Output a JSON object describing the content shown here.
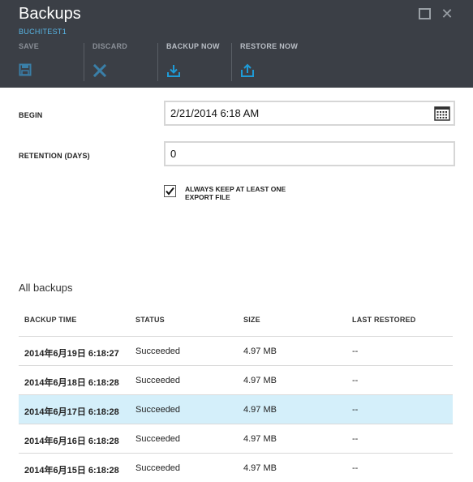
{
  "blade": {
    "title": "Backups",
    "subtitle": "BUCHITEST1"
  },
  "commands": [
    {
      "label": "SAVE",
      "icon": "save-icon",
      "enabled": false
    },
    {
      "label": "DISCARD",
      "icon": "discard-icon",
      "enabled": false
    },
    {
      "label": "BACKUP NOW",
      "icon": "backup-now-icon",
      "enabled": true
    },
    {
      "label": "RESTORE NOW",
      "icon": "restore-now-icon",
      "enabled": true
    }
  ],
  "form": {
    "begin_label": "BEGIN",
    "begin_value": "2/21/2014 6:18 AM",
    "retention_label": "RETENTION (DAYS)",
    "retention_value": "0",
    "keep_export_label": "ALWAYS KEEP AT LEAST ONE EXPORT FILE",
    "keep_export_checked": true
  },
  "backups": {
    "title": "All backups",
    "columns": [
      "BACKUP TIME",
      "STATUS",
      "SIZE",
      "LAST RESTORED"
    ],
    "rows": [
      {
        "time": "2014年6月19日 6:18:27",
        "status": "Succeeded",
        "size": "4.97 MB",
        "last_restored": "--"
      },
      {
        "time": "2014年6月18日 6:18:28",
        "status": "Succeeded",
        "size": "4.97 MB",
        "last_restored": "--"
      },
      {
        "time": "2014年6月17日 6:18:28",
        "status": "Succeeded",
        "size": "4.97 MB",
        "last_restored": "--"
      },
      {
        "time": "2014年6月16日 6:18:28",
        "status": "Succeeded",
        "size": "4.97 MB",
        "last_restored": "--"
      },
      {
        "time": "2014年6月15日 6:18:28",
        "status": "Succeeded",
        "size": "4.97 MB",
        "last_restored": "--"
      }
    ],
    "selected_row": 2
  },
  "colors": {
    "header_bg": "#3b3f46",
    "accent": "#1e9bd7",
    "selected_row": "#d4effa"
  }
}
